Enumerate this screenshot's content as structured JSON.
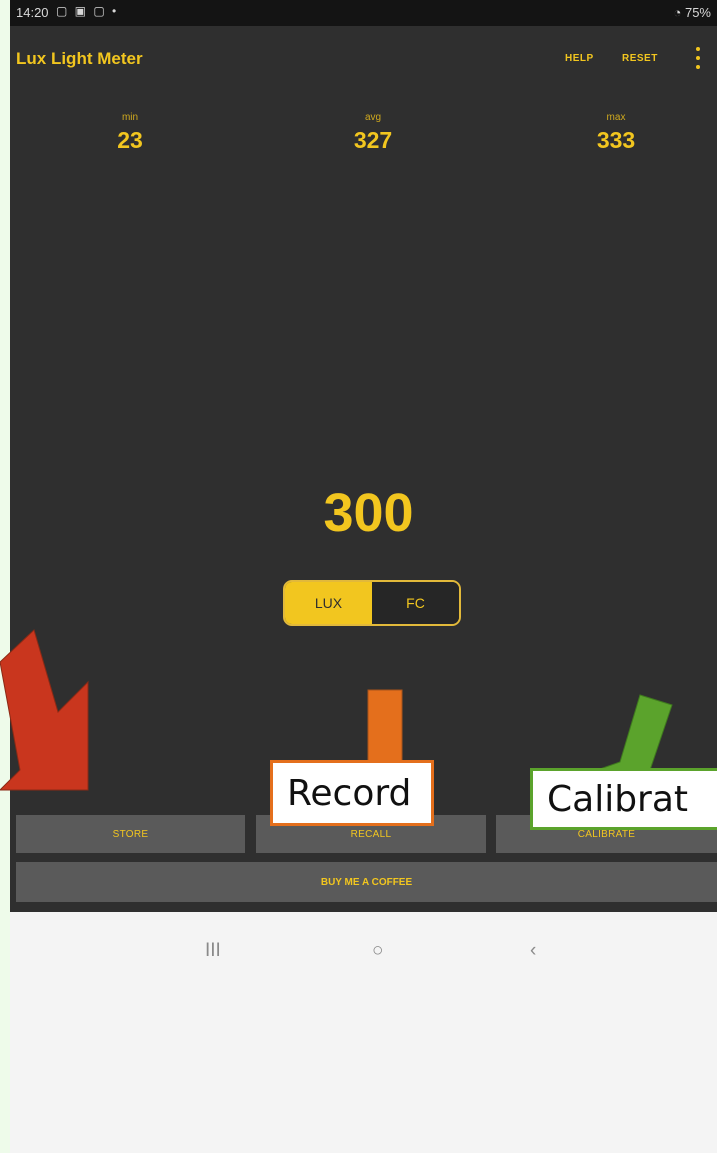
{
  "status_bar": {
    "time": "14:20",
    "notif_icons": "▢ ▣ ▢ •",
    "battery": "75%"
  },
  "app_bar": {
    "title": "Lux Light Meter",
    "help_label": "HELP",
    "reset_label": "RESET",
    "overflow_icon": "more-vert-icon"
  },
  "stats": {
    "min": {
      "label": "min",
      "value": "23"
    },
    "avg": {
      "label": "avg",
      "value": "327"
    },
    "max": {
      "label": "max",
      "value": "333"
    }
  },
  "reading": {
    "value": "300",
    "selected_unit": "LUX"
  },
  "unit_toggle": {
    "lux_label": "LUX",
    "fc_label": "FC"
  },
  "buttons": {
    "store": "STORE",
    "recall": "RECALL",
    "calibrate": "CALIBRATE",
    "coffee": "BUY ME A COFFEE"
  },
  "nav": {
    "recents": "III",
    "home": "○",
    "back": "‹"
  },
  "annotations": {
    "record": "Record",
    "calibrate": "Calibrat",
    "colors": {
      "store_arrow": "#c9361e",
      "record": "#e46f1c",
      "calibrate": "#5ba32c"
    }
  },
  "theme": {
    "accent": "#f2c61f",
    "background": "#2f2f2f",
    "button": "#5a5a5a"
  }
}
